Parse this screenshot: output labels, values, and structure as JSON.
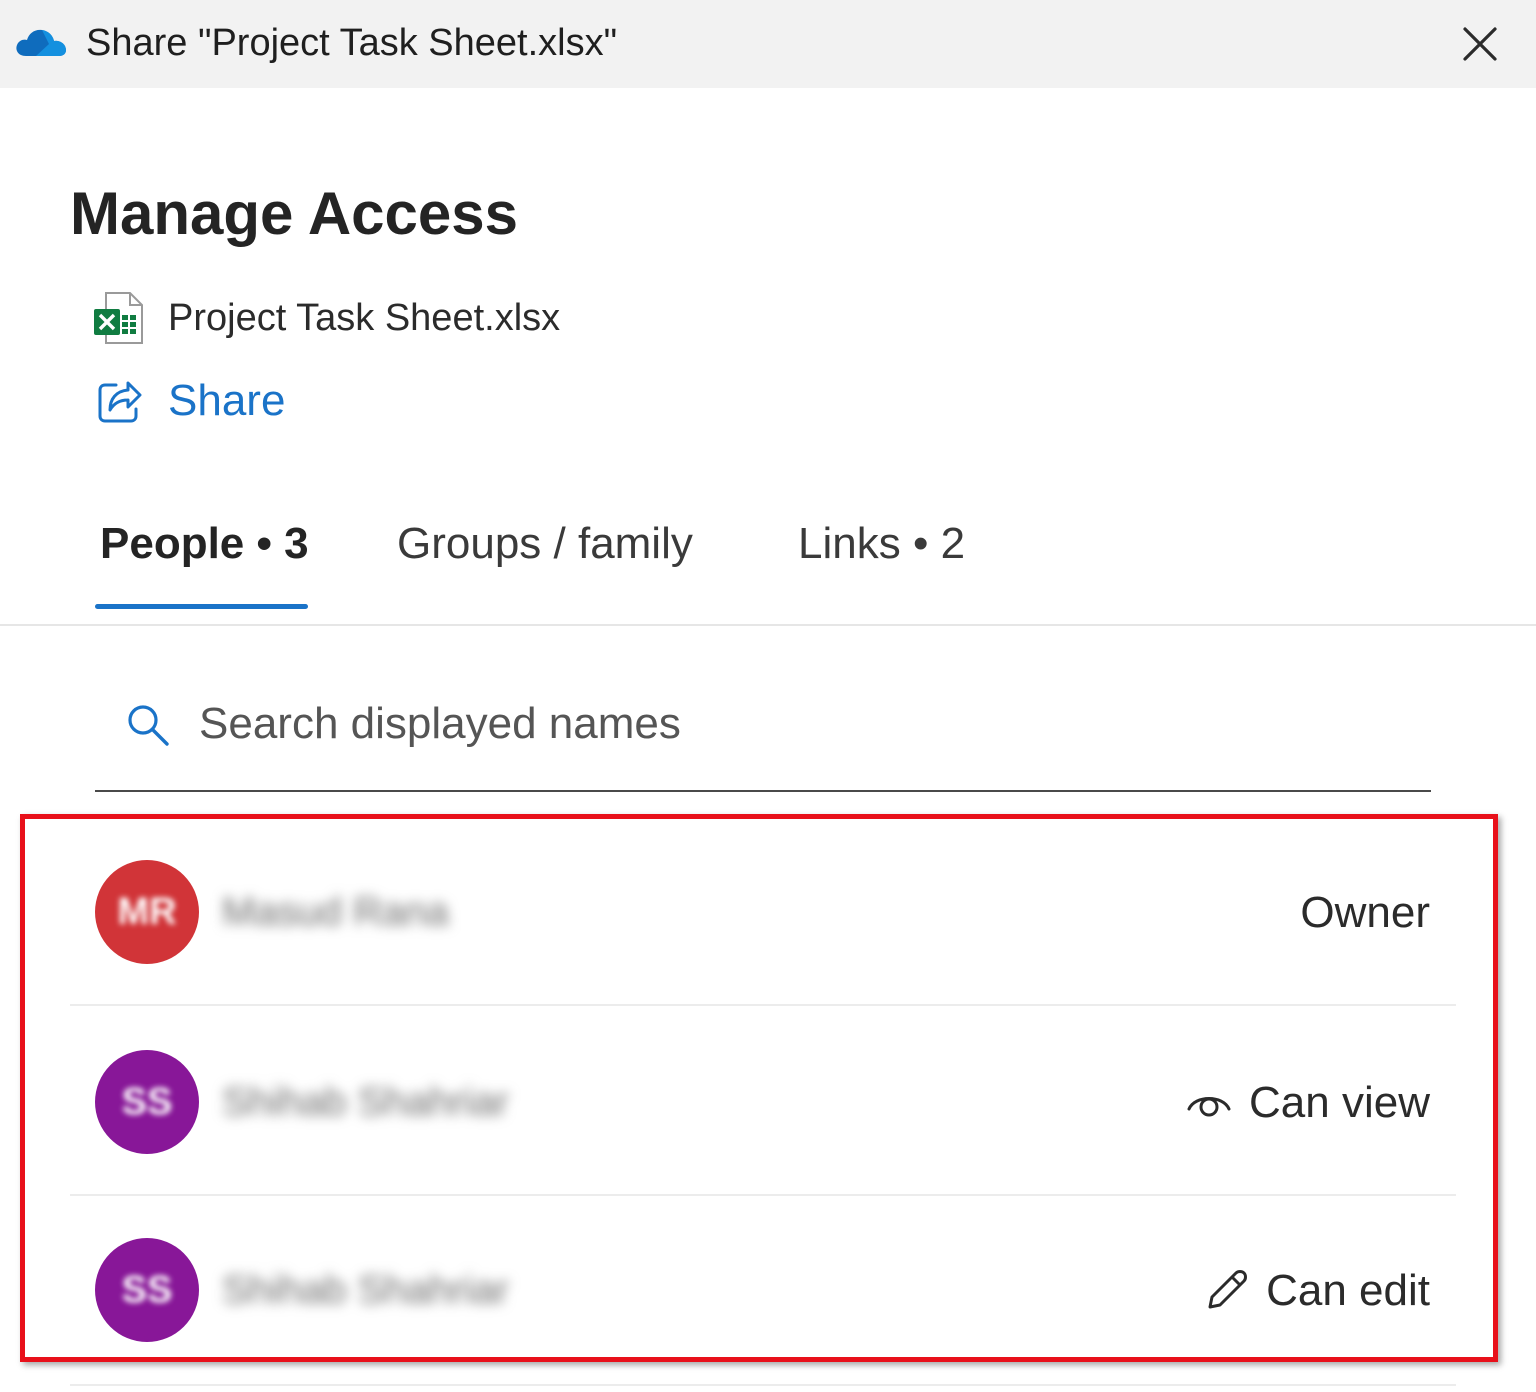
{
  "window": {
    "title": "Share \"Project Task Sheet.xlsx\"",
    "app_icon": "onedrive-cloud-icon",
    "close_icon": "close-icon"
  },
  "dialog": {
    "heading": "Manage Access",
    "file": {
      "name": "Project Task Sheet.xlsx",
      "icon": "excel-file-icon"
    },
    "share": {
      "label": "Share",
      "icon": "share-icon"
    }
  },
  "tabs": [
    {
      "label": "People • 3",
      "active": true
    },
    {
      "label": "Groups / family",
      "active": false
    },
    {
      "label": "Links • 2",
      "active": false
    }
  ],
  "search": {
    "placeholder": "Search displayed names",
    "value": "",
    "icon": "search-icon"
  },
  "people": [
    {
      "initials": "MR",
      "name": "Masud Rana",
      "avatar_color": "#d13438",
      "permission": "Owner",
      "permission_icon": ""
    },
    {
      "initials": "SS",
      "name": "Shihab Shahriar",
      "avatar_color": "#881798",
      "permission": "Can view",
      "permission_icon": "eye-icon"
    },
    {
      "initials": "SS",
      "name": "Shihab Shahriar",
      "avatar_color": "#881798",
      "permission": "Can edit",
      "permission_icon": "pencil-icon"
    }
  ],
  "colors": {
    "accent": "#1a73c8",
    "highlight_border": "#e8101a",
    "titlebar_bg": "#f2f2f2"
  }
}
